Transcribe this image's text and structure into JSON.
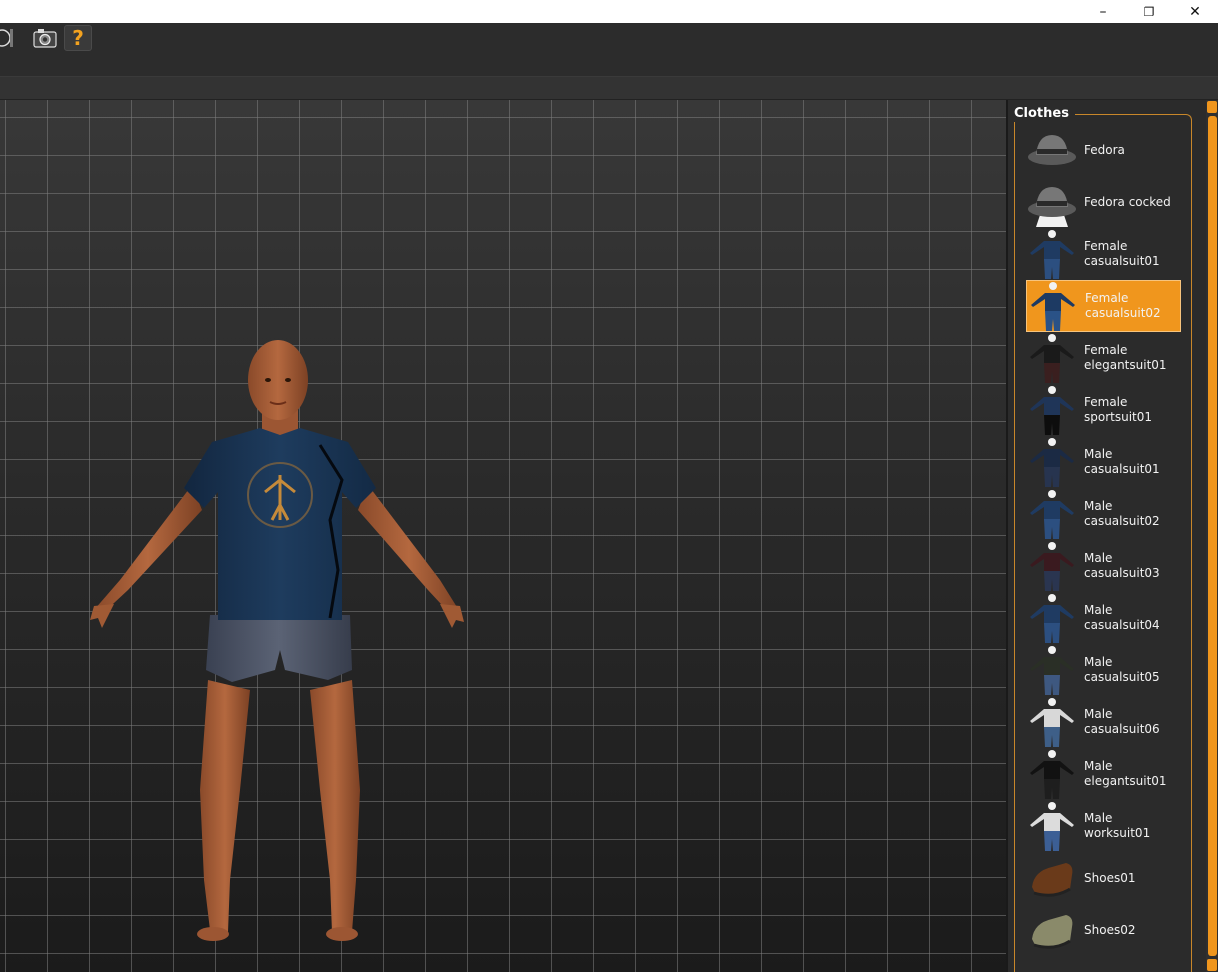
{
  "window": {
    "minimize_glyph": "–",
    "restore_glyph": "❐",
    "close_glyph": "✕"
  },
  "toolbar": {
    "help_label": "?",
    "icons": [
      "sphere-gizmo-icon",
      "camera-icon",
      "help-icon"
    ]
  },
  "panel": {
    "title": "Clothes",
    "items": [
      {
        "label": "Fedora",
        "thumb": "fedora",
        "selected": false
      },
      {
        "label": "Fedora cocked",
        "thumb": "fedora-cocked",
        "selected": false
      },
      {
        "label": "Female\ncasualsuit01",
        "thumb": "suit-blue",
        "selected": false
      },
      {
        "label": "Female\ncasualsuit02",
        "thumb": "suit-blue2",
        "selected": true
      },
      {
        "label": "Female\nelegantsuit01",
        "thumb": "suit-dark",
        "selected": false
      },
      {
        "label": "Female\nsportsuit01",
        "thumb": "suit-sport",
        "selected": false
      },
      {
        "label": "Male\ncasualsuit01",
        "thumb": "suit-navy",
        "selected": false
      },
      {
        "label": "Male\ncasualsuit02",
        "thumb": "suit-blue",
        "selected": false
      },
      {
        "label": "Male\ncasualsuit03",
        "thumb": "suit-maroon",
        "selected": false
      },
      {
        "label": "Male\ncasualsuit04",
        "thumb": "suit-blue",
        "selected": false
      },
      {
        "label": "Male\ncasualsuit05",
        "thumb": "suit-olive",
        "selected": false
      },
      {
        "label": "Male\ncasualsuit06",
        "thumb": "suit-white",
        "selected": false
      },
      {
        "label": "Male\nelegantsuit01",
        "thumb": "suit-black",
        "selected": false
      },
      {
        "label": "Male worksuit01",
        "thumb": "suit-overall",
        "selected": false
      },
      {
        "label": "Shoes01",
        "thumb": "shoe-brown",
        "selected": false
      },
      {
        "label": "Shoes02",
        "thumb": "shoe-sneaker",
        "selected": false
      }
    ]
  },
  "colors": {
    "accent": "#f0961d",
    "panel_bg": "#2b2b2b",
    "viewport_bg": "#1e1e1e"
  }
}
